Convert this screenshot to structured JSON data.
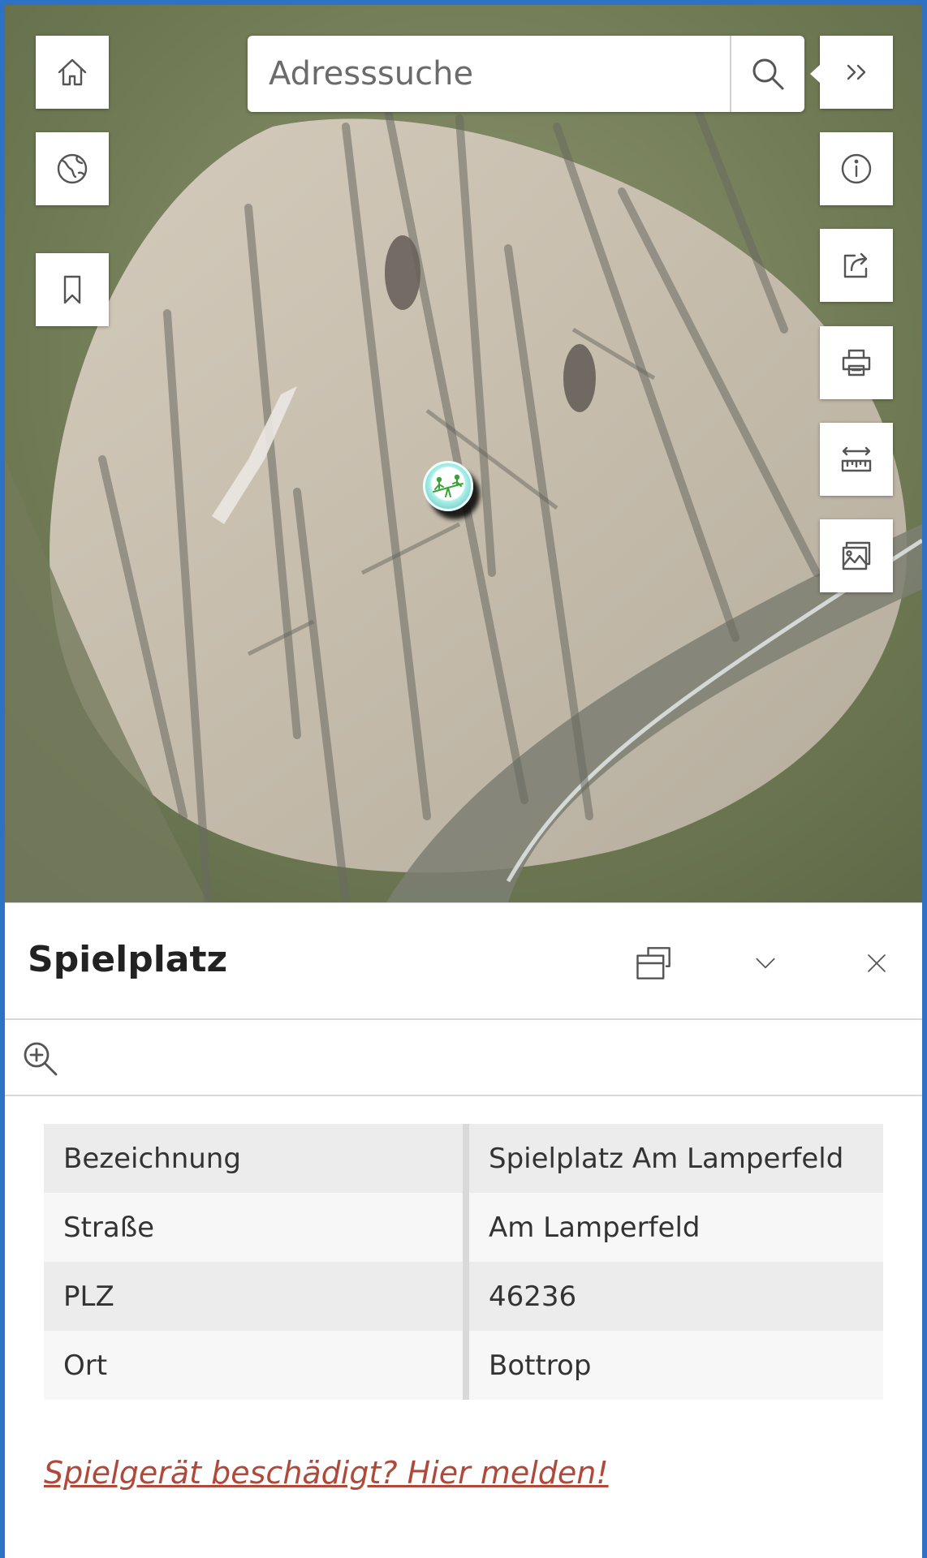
{
  "map": {
    "search": {
      "placeholder": "Adresssuche"
    },
    "left_tools": [
      {
        "name": "home-button",
        "icon": "home-icon"
      },
      {
        "name": "basemap-button",
        "icon": "globe-icon"
      },
      {
        "name": "bookmarks-button",
        "icon": "bookmark-icon"
      }
    ],
    "right_tools": [
      {
        "name": "expand-toolbar-button",
        "icon": "double-chevron-right-icon"
      },
      {
        "name": "info-button",
        "icon": "info-icon"
      },
      {
        "name": "share-button",
        "icon": "share-icon"
      },
      {
        "name": "print-button",
        "icon": "print-icon"
      },
      {
        "name": "measure-button",
        "icon": "measure-icon"
      },
      {
        "name": "legend-button",
        "icon": "image-icon"
      }
    ],
    "marker": {
      "icon": "playground-icon",
      "color": "#4fb7b0"
    }
  },
  "popup": {
    "title": "Spielplatz",
    "actions": [
      {
        "name": "dock-button",
        "icon": "dock-icon"
      },
      {
        "name": "collapse-button",
        "icon": "chevron-down-icon"
      },
      {
        "name": "close-button",
        "icon": "close-icon"
      }
    ],
    "zoom_icon": "zoom-in-icon",
    "attributes": [
      {
        "key": "Bezeichnung",
        "value": "Spielplatz Am Lamperfeld"
      },
      {
        "key": "Straße",
        "value": "Am Lamperfeld"
      },
      {
        "key": "PLZ",
        "value": "46236"
      },
      {
        "key": "Ort",
        "value": "Bottrop"
      }
    ],
    "report_link": "Spielgerät beschädigt? Hier melden!"
  },
  "colors": {
    "frame": "#2d72c4",
    "link": "#b0493a",
    "marker": "#4fb7b0"
  }
}
